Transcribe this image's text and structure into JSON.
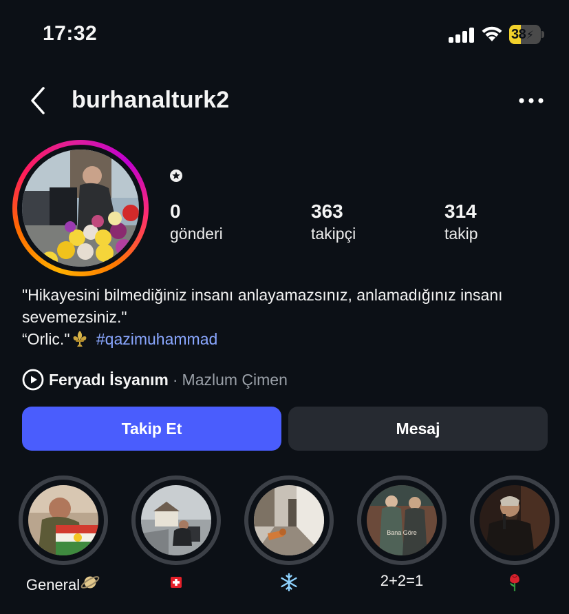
{
  "status_bar": {
    "time": "17:32",
    "battery_percent": 38,
    "battery_text": "38",
    "battery_color": "#f2d12b",
    "icons": [
      "cellular-signal-icon",
      "wifi-icon",
      "battery-charging-icon"
    ]
  },
  "header": {
    "username": "burhanalturk2",
    "back_icon": "chevron-left-icon",
    "more_icon": "ellipsis-icon"
  },
  "profile": {
    "badge_icon": "star-circle-icon",
    "stats": [
      {
        "value": "0",
        "label": "gönderi"
      },
      {
        "value": "363",
        "label": "takipçi"
      },
      {
        "value": "314",
        "label": "takip"
      }
    ],
    "bio": {
      "line1": "\"Hikayesini bilmediğiniz insanı anlayamazsınız, anlamadığınız insanı",
      "line2": "sevemezsiniz.\"",
      "line3_prefix": "“Orlic.\"",
      "line3_emoji": "fleur-de-lis-icon",
      "hashtag": "#qazimuhammad"
    },
    "music": {
      "icon": "play-circle-icon",
      "song": "Feryadı İsyanım",
      "separator": "·",
      "artist": "Mazlum Çimen"
    }
  },
  "actions": {
    "follow_label": "Takip Et",
    "message_label": "Mesaj",
    "follow_color": "#4a5dfd",
    "message_color": "#262a31"
  },
  "highlights": [
    {
      "label": "General",
      "emoji": "saturn-icon"
    },
    {
      "label": "",
      "emoji": "swiss-flag-icon"
    },
    {
      "label": "",
      "emoji": "snowflake-icon"
    },
    {
      "label": "2+2=1",
      "emoji": ""
    },
    {
      "label": "",
      "emoji": "rose-icon"
    }
  ],
  "highlight_image_texts": {
    "h4": "Bana Göre"
  }
}
